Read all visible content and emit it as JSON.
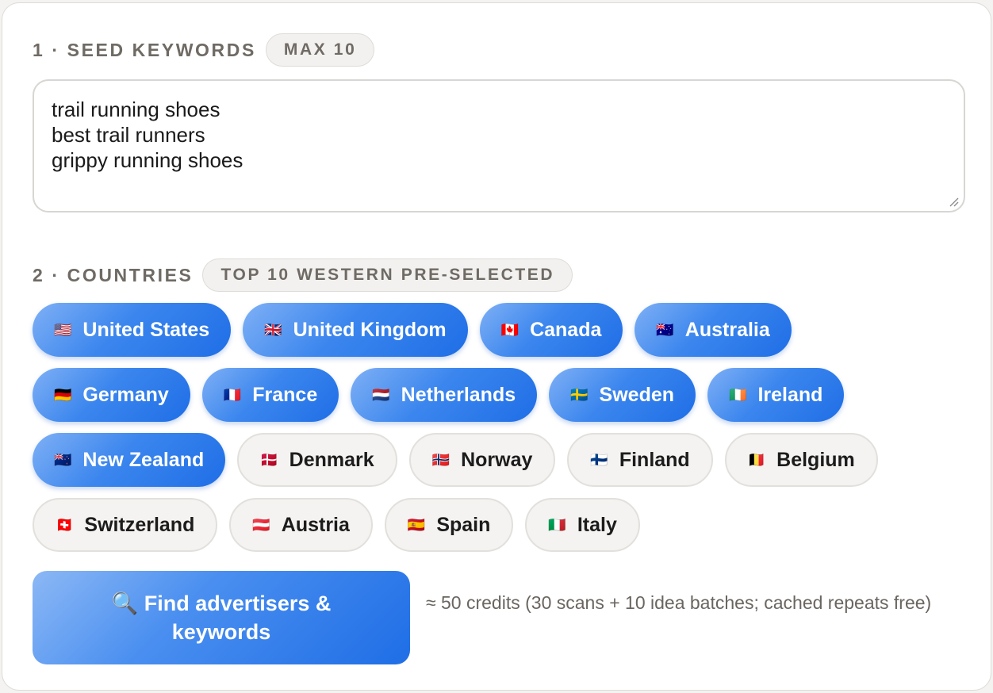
{
  "seed": {
    "title": "1 · SEED KEYWORDS",
    "badge": "MAX 10",
    "keywords": [
      "trail running shoes",
      "best trail runners",
      "grippy running shoes"
    ]
  },
  "countries": {
    "title": "2 · COUNTRIES",
    "badge": "TOP 10 WESTERN PRE-SELECTED",
    "rows": [
      [
        {
          "flag": "🇺🇸",
          "name": "United States",
          "selected": true
        },
        {
          "flag": "🇬🇧",
          "name": "United Kingdom",
          "selected": true
        },
        {
          "flag": "🇨🇦",
          "name": "Canada",
          "selected": true
        },
        {
          "flag": "🇦🇺",
          "name": "Australia",
          "selected": true
        }
      ],
      [
        {
          "flag": "🇩🇪",
          "name": "Germany",
          "selected": true
        },
        {
          "flag": "🇫🇷",
          "name": "France",
          "selected": true
        },
        {
          "flag": "🇳🇱",
          "name": "Netherlands",
          "selected": true
        },
        {
          "flag": "🇸🇪",
          "name": "Sweden",
          "selected": true
        },
        {
          "flag": "🇮🇪",
          "name": "Ireland",
          "selected": true
        }
      ],
      [
        {
          "flag": "🇳🇿",
          "name": "New Zealand",
          "selected": true
        },
        {
          "flag": "🇩🇰",
          "name": "Denmark",
          "selected": false
        },
        {
          "flag": "🇳🇴",
          "name": "Norway",
          "selected": false
        },
        {
          "flag": "🇫🇮",
          "name": "Finland",
          "selected": false
        },
        {
          "flag": "🇧🇪",
          "name": "Belgium",
          "selected": false
        }
      ],
      [
        {
          "flag": "🇨🇭",
          "name": "Switzerland",
          "selected": false
        },
        {
          "flag": "🇦🇹",
          "name": "Austria",
          "selected": false
        },
        {
          "flag": "🇪🇸",
          "name": "Spain",
          "selected": false
        },
        {
          "flag": "🇮🇹",
          "name": "Italy",
          "selected": false
        }
      ]
    ]
  },
  "action": {
    "icon": "🔍",
    "icon_name": "magnifier-icon",
    "label": "Find advertisers & keywords",
    "credits_note": "≈ 50 credits (30 scans + 10 idea batches; cached repeats free)"
  },
  "colors": {
    "selected_chip": "#2f7bea",
    "unselected_chip": "#f4f3f1",
    "section_title": "#6f6a64"
  }
}
